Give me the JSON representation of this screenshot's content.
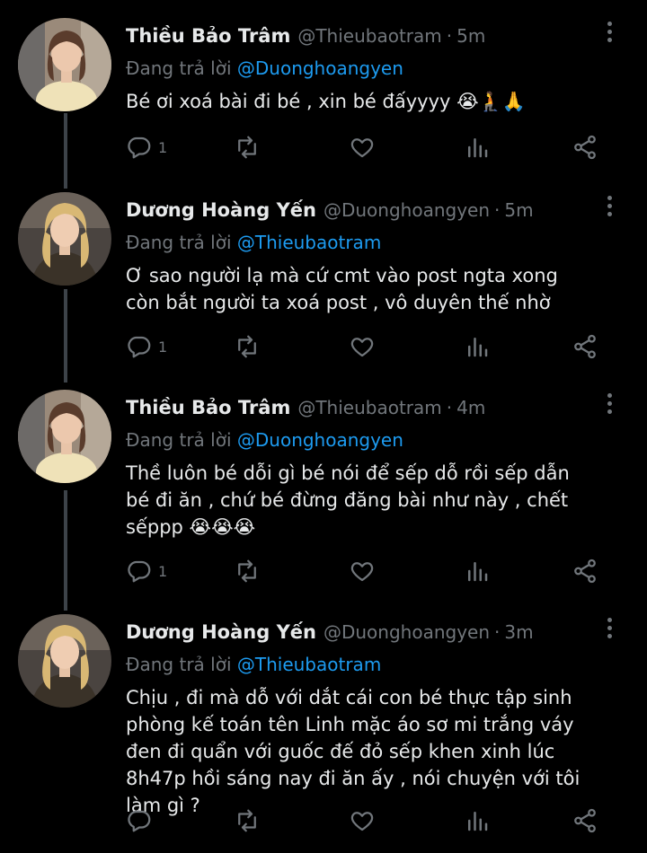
{
  "colors": {
    "background": "#000000",
    "text": "#e7e9ea",
    "secondary": "#71767b",
    "link": "#1d9bf0",
    "thread_line": "#3d4349"
  },
  "replying_prefix": "Đang trả lời",
  "tweets": [
    {
      "name": "Thiều Bảo Trâm",
      "handle": "@Thieubaotram",
      "sep": "·",
      "time": "5m",
      "reply_to": "@Duonghoangyen",
      "text": "Bé ơi xoá bài đi bé , xin bé đấyyyy 😭🧎🙏",
      "reply_count": "1",
      "avatar_icon": "avatar-thieu-bao-tram"
    },
    {
      "name": "Dương Hoàng Yến",
      "handle": "@Duonghoangyen",
      "sep": "·",
      "time": "5m",
      "reply_to": "@Thieubaotram",
      "text": "Ơ sao người lạ mà cứ cmt vào post ngta xong còn bắt người ta xoá post , vô duyên thế nhờ",
      "reply_count": "1",
      "avatar_icon": "avatar-duong-hoang-yen"
    },
    {
      "name": "Thiều Bảo Trâm",
      "handle": "@Thieubaotram",
      "sep": "·",
      "time": "4m",
      "reply_to": "@Duonghoangyen",
      "text": "Thề luôn bé dỗi gì bé nói để sếp dỗ rồi sếp dẫn bé đi ăn , chứ bé đừng đăng bài như này , chết sếppp 😭😭😭",
      "reply_count": "1",
      "avatar_icon": "avatar-thieu-bao-tram"
    },
    {
      "name": "Dương Hoàng Yến",
      "handle": "@Duonghoangyen",
      "sep": "·",
      "time": "3m",
      "reply_to": "@Thieubaotram",
      "text": "Chịu , đi mà dỗ với dắt cái con bé thực tập sinh phòng kế toán tên Linh mặc áo sơ mi trắng váy đen đi quẩn với guốc đế đỏ sếp khen xinh lúc 8h47p hồi sáng nay đi ăn ấy , nói chuyện với tôi làm gì ?",
      "reply_count": "",
      "avatar_icon": "avatar-duong-hoang-yen"
    }
  ]
}
